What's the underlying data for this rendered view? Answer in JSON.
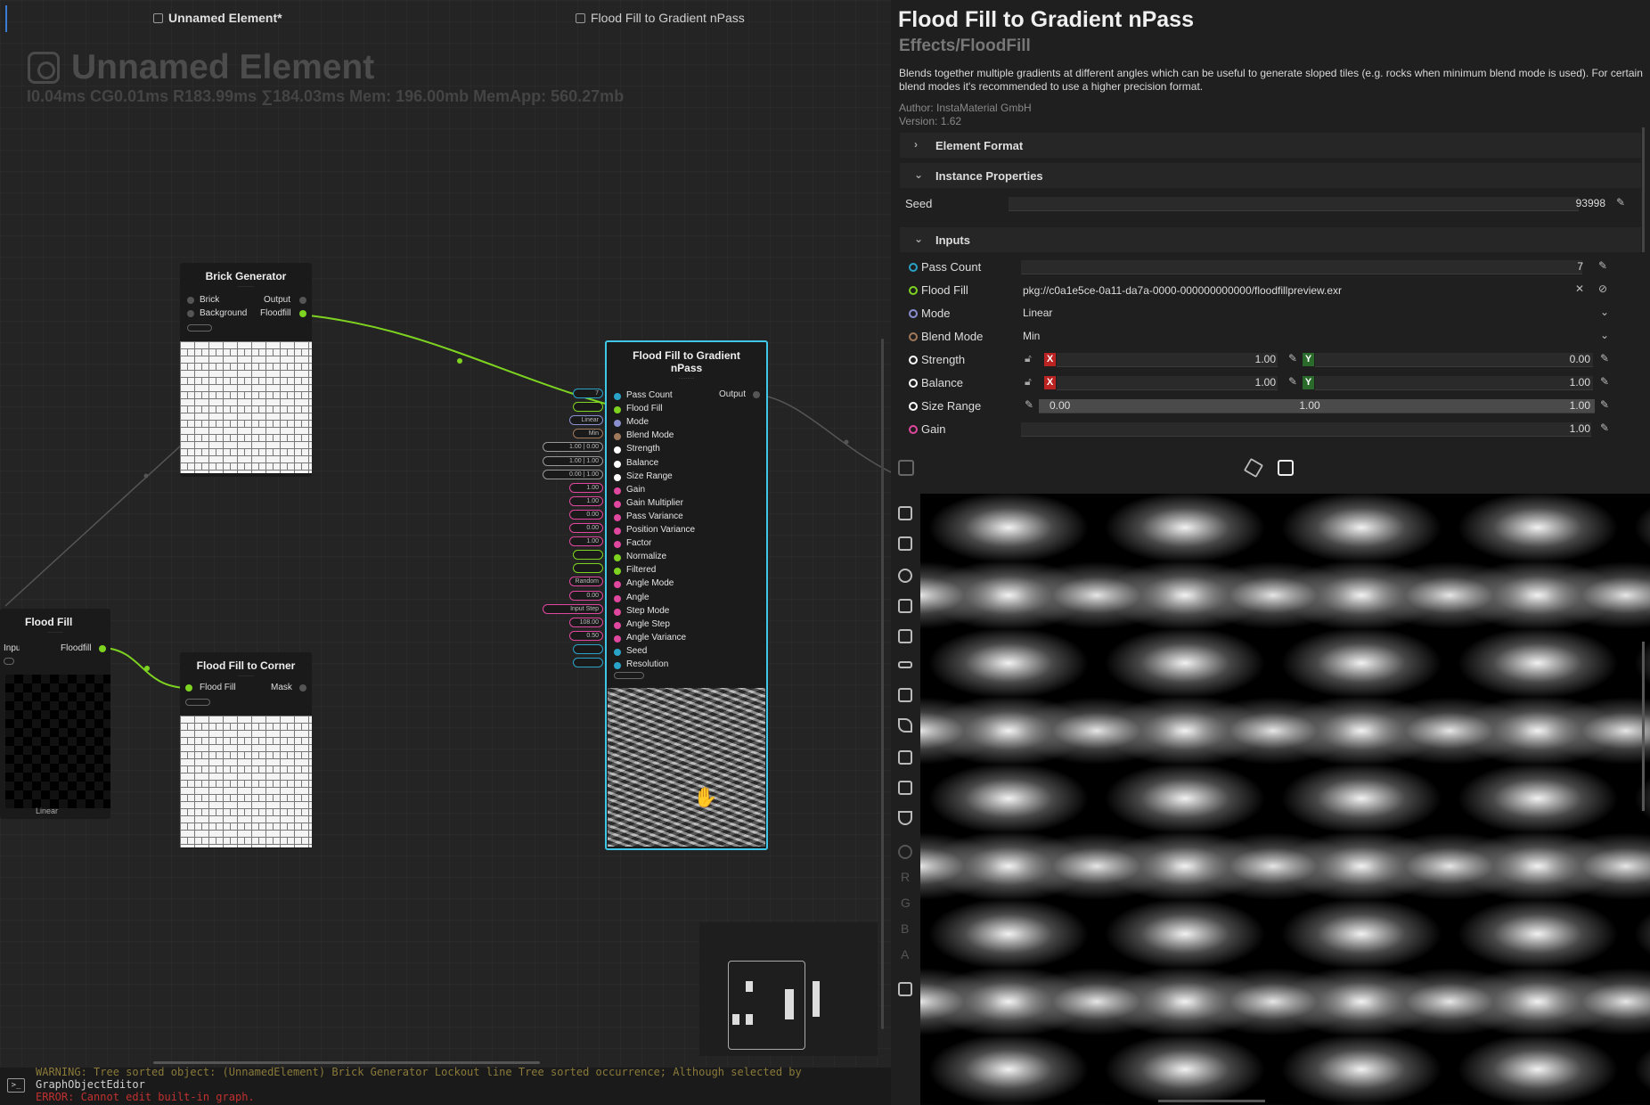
{
  "graph": {
    "tabs": [
      {
        "label": "Unnamed Element*"
      },
      {
        "label": "Flood Fill to Gradient nPass"
      }
    ],
    "element_title": "Unnamed Element",
    "stats": "I0.04ms CG0.01ms R183.99ms ∑184.03ms Mem: 196.00mb MemApp: 560.27mb",
    "nodes": {
      "brick_generator": {
        "title": "Brick Generator",
        "ports_in": [
          "Brick",
          "Background"
        ],
        "ports_out": [
          "Output",
          "Floodfill"
        ]
      },
      "flood_fill": {
        "title": "Flood Fill",
        "port_in": "Input",
        "port_out": "Floodfill",
        "footer": "Linear"
      },
      "flood_fill_corner": {
        "title": "Flood Fill to Corner",
        "port_in": "Flood Fill",
        "port_out": "Mask"
      },
      "main": {
        "title": "Flood Fill to Gradient nPass",
        "output": "Output",
        "inputs": [
          {
            "label": "Pass Count",
            "color": "#2aa3c9",
            "chip": "7"
          },
          {
            "label": "Flood Fill",
            "color": "#7ed321",
            "chip": ""
          },
          {
            "label": "Mode",
            "color": "#8a8fd0",
            "chip": "Linear"
          },
          {
            "label": "Blend Mode",
            "color": "#a0785a",
            "chip": "Min"
          },
          {
            "label": "Strength",
            "color": "#ffffff",
            "chip": "1.00 | 0.00"
          },
          {
            "label": "Balance",
            "color": "#ffffff",
            "chip": "1.00 | 1.00"
          },
          {
            "label": "Size Range",
            "color": "#ffffff",
            "chip": "0.00 | 1.00"
          },
          {
            "label": "Gain",
            "color": "#e0479e",
            "chip": "1.00"
          },
          {
            "label": "Gain Multiplier",
            "color": "#e0479e",
            "chip": "1.00"
          },
          {
            "label": "Pass Variance",
            "color": "#e0479e",
            "chip": "0.00"
          },
          {
            "label": "Position Variance",
            "color": "#e0479e",
            "chip": "0.00"
          },
          {
            "label": "Factor",
            "color": "#e0479e",
            "chip": "1.00"
          },
          {
            "label": "Normalize",
            "color": "#7ed321",
            "chip": ""
          },
          {
            "label": "Filtered",
            "color": "#7ed321",
            "chip": ""
          },
          {
            "label": "Angle Mode",
            "color": "#e0479e",
            "chip": "Random"
          },
          {
            "label": "Angle",
            "color": "#e0479e",
            "chip": "0.00"
          },
          {
            "label": "Step Mode",
            "color": "#e0479e",
            "chip": "Input Step"
          },
          {
            "label": "Angle Step",
            "color": "#e0479e",
            "chip": "108.00"
          },
          {
            "label": "Angle Variance",
            "color": "#e0479e",
            "chip": "0.50"
          },
          {
            "label": "Seed",
            "color": "#2aa3c9",
            "chip": ""
          },
          {
            "label": "Resolution",
            "color": "#2aa3c9",
            "chip": ""
          }
        ]
      }
    },
    "console": [
      "WARNING: Tree sorted object: (UnnamedElement) Brick Generator  Lockout line  Tree sorted occurrence;  Although selected by",
      "GraphObjectEditor",
      "ERROR: Cannot edit built-in graph."
    ]
  },
  "props": {
    "title": "Flood Fill to Gradient nPass",
    "category": "Effects/FloodFill",
    "description": "Blends together multiple gradients at different angles which can be useful to generate sloped tiles (e.g. rocks when minimum blend mode is used). For certain blend modes it's recommended to use a higher precision format.",
    "author": "Author: InstaMaterial GmbH",
    "version": "Version: 1.62",
    "sections": {
      "element_format": "Element Format",
      "instance_properties": "Instance Properties",
      "inputs": "Inputs"
    },
    "seed": {
      "label": "Seed",
      "value": "93998"
    },
    "inputs": {
      "pass_count": {
        "label": "Pass Count",
        "value": "7"
      },
      "flood_fill": {
        "label": "Flood Fill",
        "value": "pkg://c0a1e5ce-0a11-da7a-0000-000000000000/floodfillpreview.exr"
      },
      "mode": {
        "label": "Mode",
        "value": "Linear"
      },
      "blend_mode": {
        "label": "Blend Mode",
        "value": "Min"
      },
      "strength": {
        "label": "Strength",
        "x": "1.00",
        "y": "0.00"
      },
      "balance": {
        "label": "Balance",
        "x": "1.00",
        "y": "1.00"
      },
      "size_range": {
        "label": "Size Range",
        "min": "0.00",
        "mid": "1.00",
        "max": "1.00"
      },
      "gain": {
        "label": "Gain",
        "value": "1.00"
      }
    },
    "axis_x": "X",
    "axis_y": "Y"
  },
  "preview": {
    "channels": [
      "R",
      "G",
      "B",
      "A"
    ]
  }
}
